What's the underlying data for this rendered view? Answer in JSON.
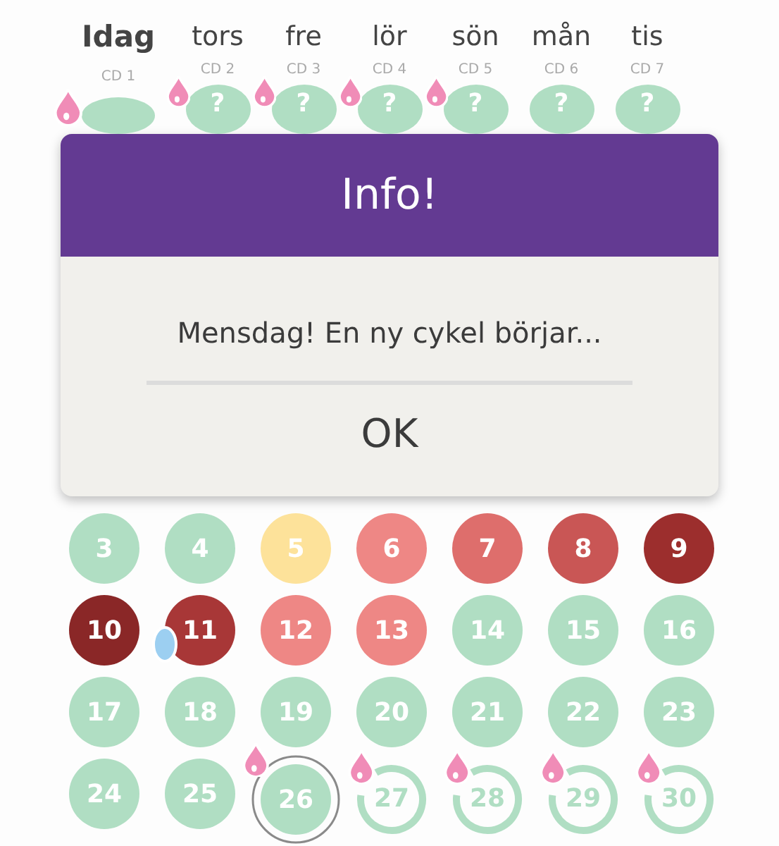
{
  "week": [
    {
      "label": "Idag",
      "cycle_day": "CD 1",
      "today": true,
      "drop": true
    },
    {
      "label": "tors",
      "cycle_day": "CD 2",
      "today": false,
      "drop": true,
      "symbol": "?"
    },
    {
      "label": "fre",
      "cycle_day": "CD 3",
      "today": false,
      "drop": true,
      "symbol": "?"
    },
    {
      "label": "lör",
      "cycle_day": "CD 4",
      "today": false,
      "drop": true,
      "symbol": "?"
    },
    {
      "label": "sön",
      "cycle_day": "CD 5",
      "today": false,
      "drop": true,
      "symbol": "?"
    },
    {
      "label": "mån",
      "cycle_day": "CD 6",
      "today": false,
      "drop": false,
      "symbol": "?"
    },
    {
      "label": "tis",
      "cycle_day": "CD 7",
      "today": false,
      "drop": false,
      "symbol": "?"
    }
  ],
  "dialog": {
    "title": "Info!",
    "message": "Mensdag! En ny cykel börjar...",
    "button": "OK"
  },
  "calendar": [
    {
      "day": "3",
      "kind": "filled",
      "color": "#b0dec3",
      "drop": false,
      "dot": false
    },
    {
      "day": "4",
      "kind": "filled",
      "color": "#b0dec3",
      "drop": false,
      "dot": false
    },
    {
      "day": "5",
      "kind": "filled",
      "color": "#fde29a",
      "drop": false,
      "dot": false
    },
    {
      "day": "6",
      "kind": "filled",
      "color": "#ee8785",
      "drop": false,
      "dot": false
    },
    {
      "day": "7",
      "kind": "filled",
      "color": "#de6e6c",
      "drop": false,
      "dot": false
    },
    {
      "day": "8",
      "kind": "filled",
      "color": "#c95655",
      "drop": false,
      "dot": false
    },
    {
      "day": "9",
      "kind": "filled",
      "color": "#9c2e2d",
      "drop": false,
      "dot": false
    },
    {
      "day": "10",
      "kind": "filled",
      "color": "#8a2727",
      "drop": false,
      "dot": false
    },
    {
      "day": "11",
      "kind": "filled",
      "color": "#a83737",
      "drop": false,
      "dot": true
    },
    {
      "day": "12",
      "kind": "filled",
      "color": "#ee8785",
      "drop": false,
      "dot": false
    },
    {
      "day": "13",
      "kind": "filled",
      "color": "#ee8785",
      "drop": false,
      "dot": false
    },
    {
      "day": "14",
      "kind": "filled",
      "color": "#b0dec3",
      "drop": false,
      "dot": false
    },
    {
      "day": "15",
      "kind": "filled",
      "color": "#b0dec3",
      "drop": false,
      "dot": false
    },
    {
      "day": "16",
      "kind": "filled",
      "color": "#b0dec3",
      "drop": false,
      "dot": false
    },
    {
      "day": "17",
      "kind": "filled",
      "color": "#b0dec3",
      "drop": false,
      "dot": false
    },
    {
      "day": "18",
      "kind": "filled",
      "color": "#b0dec3",
      "drop": false,
      "dot": false
    },
    {
      "day": "19",
      "kind": "filled",
      "color": "#b0dec3",
      "drop": false,
      "dot": false
    },
    {
      "day": "20",
      "kind": "filled",
      "color": "#b0dec3",
      "drop": false,
      "dot": false
    },
    {
      "day": "21",
      "kind": "filled",
      "color": "#b0dec3",
      "drop": false,
      "dot": false
    },
    {
      "day": "22",
      "kind": "filled",
      "color": "#b0dec3",
      "drop": false,
      "dot": false
    },
    {
      "day": "23",
      "kind": "filled",
      "color": "#b0dec3",
      "drop": false,
      "dot": false
    },
    {
      "day": "24",
      "kind": "filled",
      "color": "#b0dec3",
      "drop": false,
      "dot": false
    },
    {
      "day": "25",
      "kind": "filled",
      "color": "#b0dec3",
      "drop": false,
      "dot": false
    },
    {
      "day": "26",
      "kind": "current",
      "color": "#b0dec3",
      "drop": true,
      "dot": false
    },
    {
      "day": "27",
      "kind": "predicted",
      "color": "#b0dec3",
      "drop": true,
      "dot": false
    },
    {
      "day": "28",
      "kind": "predicted",
      "color": "#b0dec3",
      "drop": true,
      "dot": false
    },
    {
      "day": "29",
      "kind": "predicted",
      "color": "#b0dec3",
      "drop": true,
      "dot": false
    },
    {
      "day": "30",
      "kind": "predicted",
      "color": "#b0dec3",
      "drop": true,
      "dot": false
    }
  ]
}
